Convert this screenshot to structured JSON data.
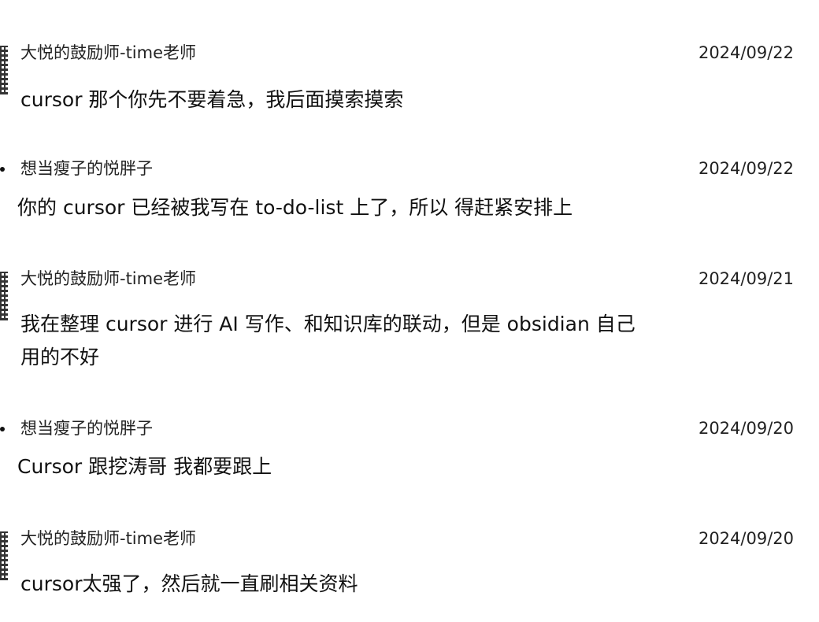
{
  "comments": [
    {
      "author": "大悦的鼓励师-time老师",
      "date": "2024/09/22",
      "text": "cursor 那个你先不要着急，我后面摸索摸索",
      "avatar": "qr-avatar"
    },
    {
      "author": "想当瘦子的悦胖子",
      "date": "2024/09/22",
      "text": "你的 cursor 已经被我写在 to-do-list 上了，所以 得赶紧安排上",
      "avatar": "dot-avatar"
    },
    {
      "author": "大悦的鼓励师-time老师",
      "date": "2024/09/21",
      "text": "我在整理 cursor 进行 AI 写作、和知识库的联动，但是 obsidian 自己用的不好",
      "avatar": "qr-avatar"
    },
    {
      "author": "想当瘦子的悦胖子",
      "date": "2024/09/20",
      "text": "Cursor 跟挖涛哥 我都要跟上",
      "avatar": "dot-avatar"
    },
    {
      "author": "大悦的鼓励师-time老师",
      "date": "2024/09/20",
      "text": "cursor太强了，然后就一直刷相关资料",
      "avatar": "qr-avatar"
    }
  ]
}
